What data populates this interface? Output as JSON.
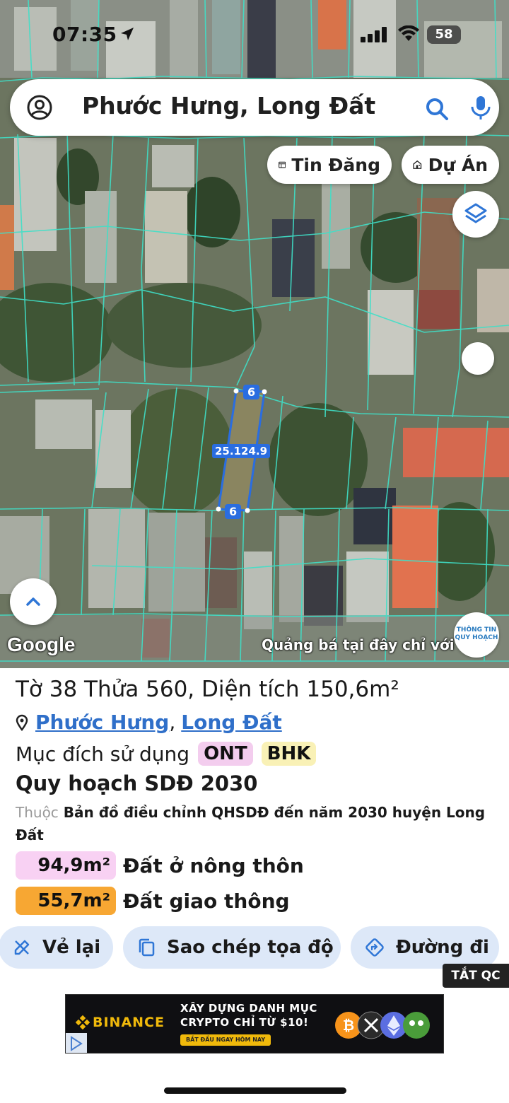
{
  "status_bar": {
    "time": "07:35",
    "battery": "58"
  },
  "search": {
    "text": "Phước Hưng, Long Đất"
  },
  "map_chips": {
    "listings": "Tin Đăng",
    "projects": "Dự Án"
  },
  "map": {
    "parcel_label": "25.124.9",
    "edge_top": "6",
    "edge_bottom": "6",
    "google_logo": "Google",
    "ad_marquee": "Quảng bá tại đây chỉ với",
    "info_badge_line1": "THÔNG TIN",
    "info_badge_line2": "QUY HOẠCH",
    "parcel_color": "#2a6de0",
    "boundary_color": "#3fe0c8"
  },
  "parcel": {
    "title": "Tờ 38 Thửa 560, Diện tích 150,6m²",
    "commune": "Phước Hưng",
    "comma": ",",
    "district": "Long Đất",
    "purpose_label": "Mục đích sử dụng",
    "purpose_codes": [
      "ONT",
      "BHK"
    ],
    "plan_title": "Quy hoạch SDĐ 2030",
    "plan_prefix": "Thuộc",
    "plan_desc": "Bản đồ điều chỉnh QHSDĐ đến năm 2030 huyện Long Đất",
    "areas": [
      {
        "value": "94,9m²",
        "label": "Đất ở nông thôn",
        "color": "#f8d1f3"
      },
      {
        "value": "55,7m²",
        "label": "Đất giao thông",
        "color": "#f7a733"
      }
    ]
  },
  "actions": {
    "redraw": "Vẻ lại",
    "copy_coords": "Sao chép tọa độ",
    "directions": "Đường đi"
  },
  "ads": {
    "hide_label": "TẮT QC",
    "brand": "BINANCE",
    "headline1": "XÂY DỰNG DANH MỤC",
    "headline2": "CRYPTO CHỈ TỪ $10!",
    "cta": "BẮT ĐẦU NGAY HÔM NAY"
  }
}
